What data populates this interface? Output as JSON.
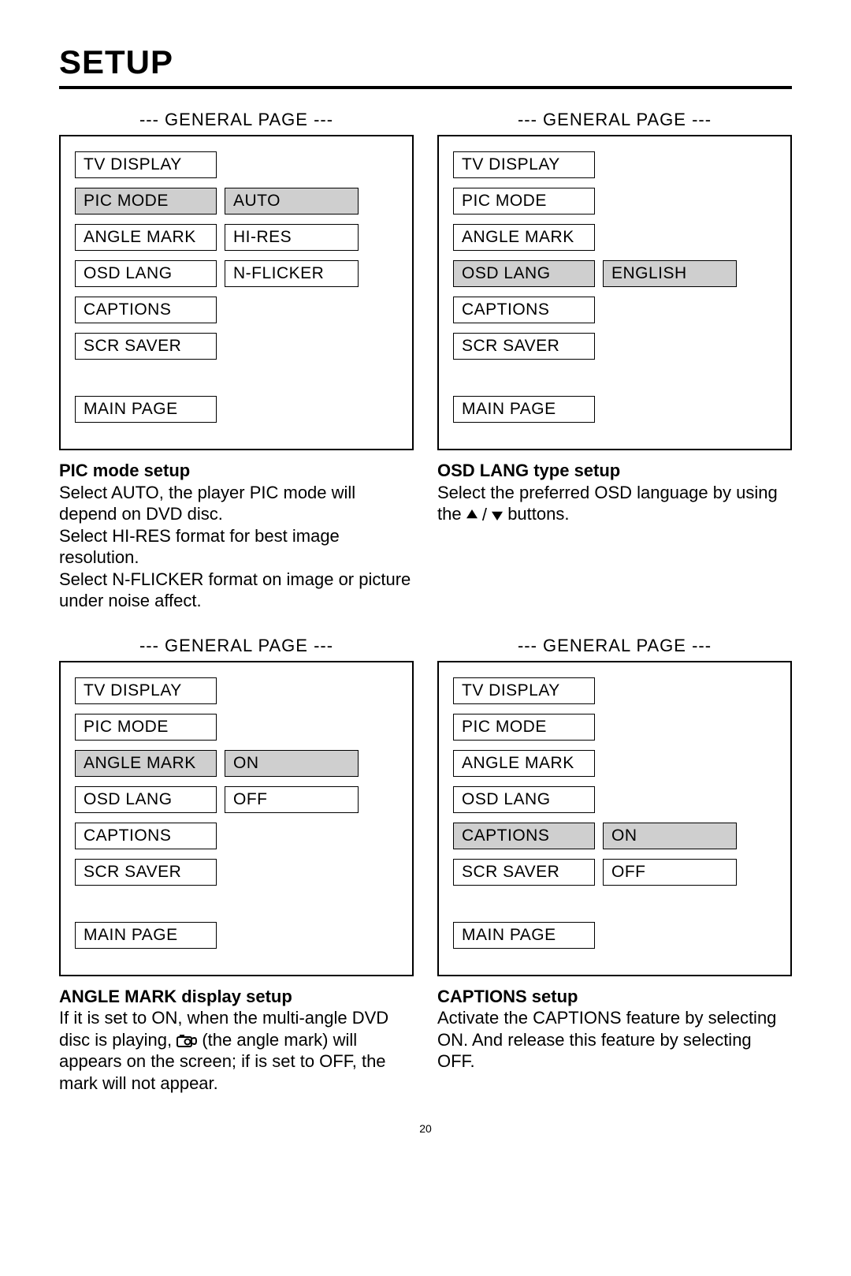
{
  "title": "SETUP",
  "page_number": "20",
  "common": {
    "panel_header": "--- GENERAL PAGE ---",
    "menu": [
      "TV DISPLAY",
      "PIC MODE",
      "ANGLE MARK",
      "OSD LANG",
      "CAPTIONS",
      "SCR SAVER"
    ],
    "main_page": "MAIN PAGE"
  },
  "panels": {
    "pic_mode": {
      "options": [
        "AUTO",
        "HI-RES",
        "N-FLICKER"
      ]
    },
    "osd_lang": {
      "options": [
        "ENGLISH"
      ]
    },
    "angle_mark": {
      "options": [
        "ON",
        "OFF"
      ]
    },
    "captions": {
      "options": [
        "ON",
        "OFF"
      ]
    }
  },
  "desc": {
    "pic_mode": {
      "title": "PIC mode setup",
      "line1": "Select AUTO, the player PIC mode will depend on DVD disc.",
      "line2": "Select HI-RES format for best image resolution.",
      "line3": "Select N-FLICKER format on image or picture under noise affect."
    },
    "osd_lang": {
      "title": "OSD LANG type setup",
      "line1a": "Select the preferred OSD language by using the",
      "line1b": " buttons."
    },
    "angle_mark": {
      "title": "ANGLE MARK display setup",
      "text_a": "If it is set to ON, when the multi-angle DVD disc is playing, ",
      "text_b": " (the angle mark) will appears on the screen; if is set to OFF, the mark will not appear."
    },
    "captions": {
      "title": "CAPTIONS setup",
      "text": "Activate the CAPTIONS feature by selecting ON.  And release this feature by selecting OFF."
    }
  }
}
